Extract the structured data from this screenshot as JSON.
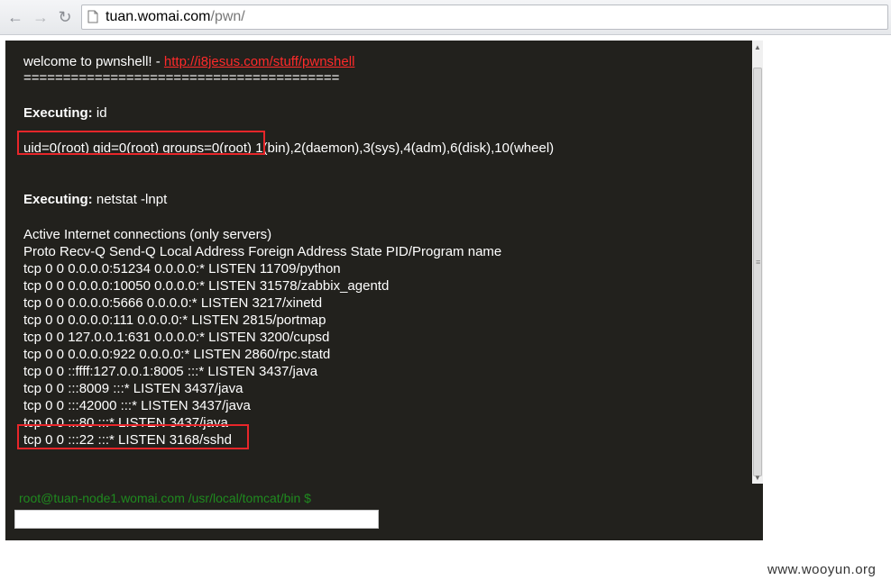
{
  "browser": {
    "url_host": "tuan.womai.com",
    "url_path": "/pwn/"
  },
  "terminal": {
    "welcome": "welcome to pwnshell! - ",
    "welcome_link": "http://i8jesus.com/stuff/pwnshell",
    "separator": "========================================",
    "exec1_label": "Executing:",
    "exec1_cmd": "id",
    "id_output": "uid=0(root) gid=0(root) groups=0(root) 1(bin),2(daemon),3(sys),4(adm),6(disk),10(wheel)",
    "exec2_label": "Executing:",
    "exec2_cmd": "netstat -lnpt",
    "netstat_lines": [
      "Active Internet connections (only servers)",
      "Proto Recv-Q Send-Q Local Address Foreign Address State PID/Program name",
      "tcp 0 0 0.0.0.0:51234 0.0.0.0:* LISTEN 11709/python",
      "tcp 0 0 0.0.0.0:10050 0.0.0.0:* LISTEN 31578/zabbix_agentd",
      "tcp 0 0 0.0.0.0:5666 0.0.0.0:* LISTEN 3217/xinetd",
      "tcp 0 0 0.0.0.0:111 0.0.0.0:* LISTEN 2815/portmap",
      "tcp 0 0 127.0.0.1:631 0.0.0.0:* LISTEN 3200/cupsd",
      "tcp 0 0 0.0.0.0:922 0.0.0.0:* LISTEN 2860/rpc.statd",
      "tcp 0 0 ::ffff:127.0.0.1:8005 :::* LISTEN 3437/java",
      "tcp 0 0 :::8009 :::* LISTEN 3437/java",
      "tcp 0 0 :::42000 :::* LISTEN 3437/java",
      "tcp 0 0 :::80 :::* LISTEN 3437/java",
      "tcp 0 0 :::22 :::* LISTEN 3168/sshd"
    ],
    "prompt": "root@tuan-node1.womai.com /usr/local/tomcat/bin $",
    "input_value": ""
  },
  "watermark": "www.wooyun.org",
  "colors": {
    "terminal_bg": "#22211d",
    "highlight": "#e8262a",
    "prompt": "#1f8a1f",
    "link": "#ff2a2a"
  },
  "icons": {
    "back": "back-arrow-icon",
    "forward": "forward-arrow-icon",
    "reload": "reload-icon",
    "page": "page-icon"
  }
}
